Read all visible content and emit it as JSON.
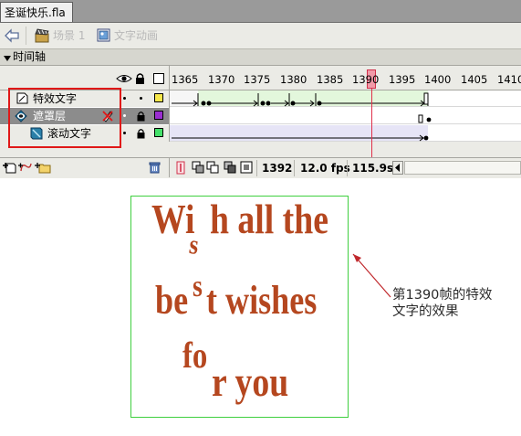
{
  "document_tab": {
    "title": "圣诞快乐.fla"
  },
  "edit_bar": {
    "back_icon": "left-arrow-icon",
    "scene_label": "场景 1",
    "symbol_label": "文字动画"
  },
  "timeline": {
    "title": "时间轴",
    "header_icons": [
      "eye-icon",
      "lock-icon",
      "outline-icon"
    ],
    "frame_numbers": [
      "1365",
      "1370",
      "1375",
      "1380",
      "1385",
      "1390",
      "1395",
      "1400",
      "1405",
      "1410"
    ],
    "current_frame_marker": "1390",
    "layers": [
      {
        "name": "特效文字",
        "type": "normal",
        "outline_color": "#f7e84a",
        "selected": false
      },
      {
        "name": "遮罩层",
        "type": "mask",
        "outline_color": "#9a2ed0",
        "selected": true
      },
      {
        "name": "滚动文字",
        "type": "masked",
        "outline_color": "#44e06a",
        "selected": false
      }
    ],
    "status": {
      "current_frame": "1392",
      "fps": "12.0 fps",
      "time": "115.9s"
    }
  },
  "stage": {
    "lines": [
      {
        "parts": [
          "Wi",
          "s",
          "h all the"
        ]
      },
      {
        "parts": [
          "be",
          "s",
          "t wishes"
        ]
      },
      {
        "parts": [
          "fo",
          "r you"
        ]
      }
    ]
  },
  "annotation": {
    "text_line1": "第1390帧的特效",
    "text_line2": "文字的效果"
  },
  "colors": {
    "highlight_box": "#e01818",
    "stage_border": "#3fcf3f",
    "text_color": "#b5471f",
    "playhead": "#e0304a",
    "tween_bg": "#d9f5d0"
  }
}
